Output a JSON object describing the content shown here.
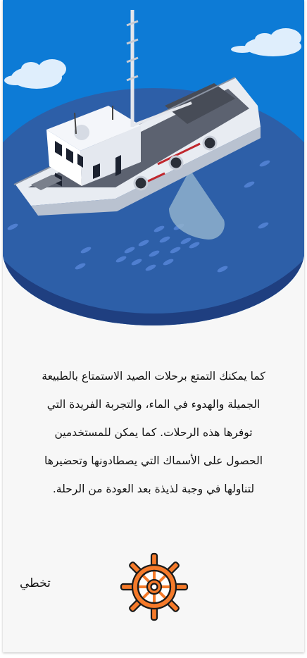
{
  "onboarding": {
    "description_lines": [
      "كما يمكنك التمتع برحلات الصيد  الاستمتاع بالطبيعة",
      "الجميلة والهدوء في الماء، والتجربة الفريدة التي",
      "توفرها هذه الرحلات. كما يمكن للمستخدمين",
      "الحصول على الأسماك التي يصطادونها وتحضيرها",
      "لتناولها في وجبة لذيذة بعد العودة من الرحلة."
    ],
    "skip_label": "تخطي"
  },
  "icons": {
    "hero": "fishing-boat-illustration",
    "wheel": "ship-wheel-icon"
  },
  "colors": {
    "sky": "#0d7bd6",
    "sea": "#2d5fa8",
    "sea_dark": "#1f3f80",
    "background": "#f7f7f7",
    "wheel_orange": "#f57a2a",
    "wheel_outline": "#1a1a1a"
  }
}
